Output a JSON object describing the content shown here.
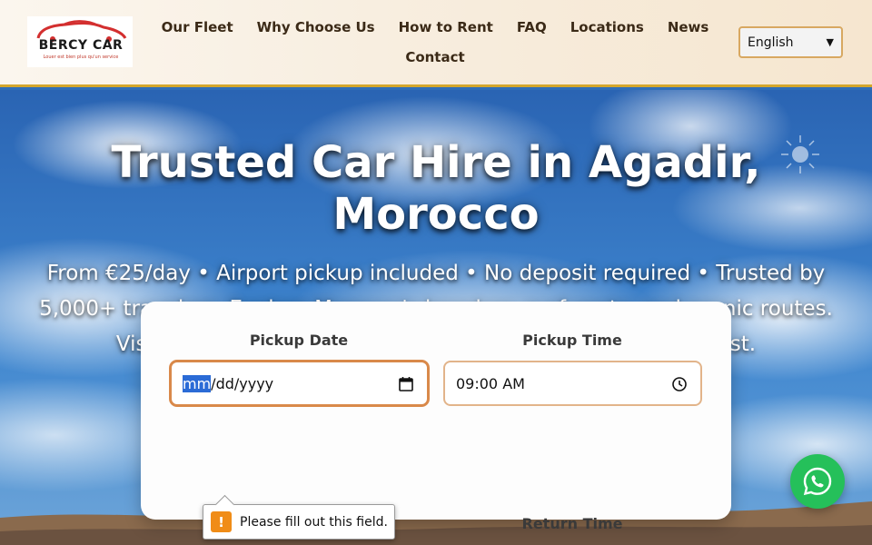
{
  "brand": {
    "name": "BERCY CAR",
    "tagline": "Louer est bien plus qu'un service"
  },
  "nav": {
    "row1": [
      "Our Fleet",
      "Why Choose Us",
      "How to Rent",
      "FAQ",
      "Locations",
      "News"
    ],
    "row2": [
      "Contact"
    ]
  },
  "language": {
    "selected": "English"
  },
  "hero": {
    "title": "Trusted Car Hire in Agadir, Morocco",
    "subtitle": "From €25/day • Airport pickup included • No deposit required • Trusted by 5,000+ travelers. Explore Morocco's beaches, surf spots, and scenic routes. Visit Taghazout, Paradise Valley, and Agadir's stunning coast."
  },
  "booking": {
    "pickup_date_label": "Pickup Date",
    "pickup_date_selected_segment": "mm",
    "pickup_date_rest": "/dd/yyyy",
    "pickup_time_label": "Pickup Time",
    "pickup_time_value": "09:00 AM",
    "return_time_label": "Return Time"
  },
  "validation": {
    "message": "Please fill out this field.",
    "icon": "!"
  },
  "icons": {
    "calendar": "calendar-icon",
    "clock": "clock-icon",
    "whatsapp": "whatsapp-icon",
    "warning": "warning-icon"
  },
  "colors": {
    "accent_gold": "#d4a72c",
    "input_border": "#e2b48a",
    "whatsapp_green": "#25c05a",
    "warning_orange": "#f08c17",
    "brand_red": "#d32f2f"
  }
}
